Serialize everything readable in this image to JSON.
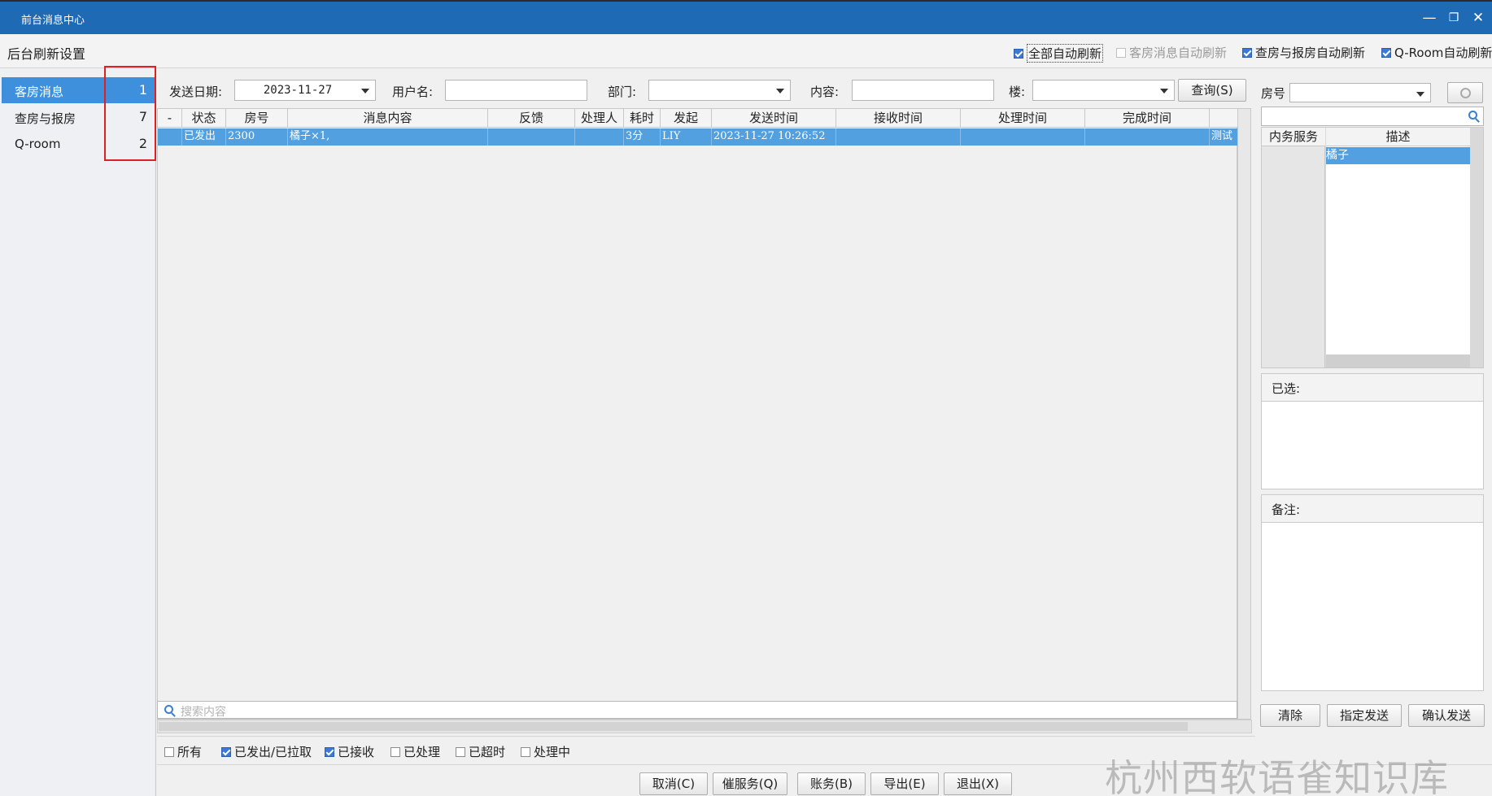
{
  "window": {
    "title": "前台消息中心",
    "minimize": "—",
    "restore": "❐",
    "close": "✕"
  },
  "settings": {
    "label": "后台刷新设置",
    "options": [
      {
        "label": "全部自动刷新",
        "checked": true
      },
      {
        "label": "客房消息自动刷新",
        "checked": false
      },
      {
        "label": "查房与报房自动刷新",
        "checked": true
      },
      {
        "label": "Q-Room自动刷新",
        "checked": true
      }
    ]
  },
  "sidebar": {
    "items": [
      {
        "label": "客房消息",
        "count": "1"
      },
      {
        "label": "查房与报房",
        "count": "7"
      },
      {
        "label": "Q-room",
        "count": "2"
      }
    ]
  },
  "filters": {
    "date_label": "发送日期:",
    "date_value": "2023-11-27",
    "user_label": "用户名:",
    "user_value": "",
    "dept_label": "部门:",
    "dept_value": "",
    "content_label": "内容:",
    "content_value": "",
    "building_label": "楼:",
    "building_value": "",
    "query_button": "查询(S)"
  },
  "table": {
    "columns": [
      "-",
      "状态",
      "房号",
      "消息内容",
      "反馈",
      "处理人",
      "耗时",
      "发起",
      "发送时间",
      "接收时间",
      "处理时间",
      "完成时间"
    ],
    "rows": [
      {
        "dash": "",
        "status": "已发出",
        "room": "2300",
        "content": "橘子×1,",
        "feedback": "",
        "handler": "",
        "duration": "3分",
        "initiator": "LIY",
        "send_time": "2023-11-27 10:26:52",
        "receive_time": "",
        "process_time": "",
        "finish_time": "",
        "extra": "测试"
      }
    ],
    "search_placeholder": "搜索内容"
  },
  "status_filters": [
    {
      "label": "所有",
      "checked": false
    },
    {
      "label": "已发出/已拉取",
      "checked": true
    },
    {
      "label": "已接收",
      "checked": true
    },
    {
      "label": "已处理",
      "checked": false
    },
    {
      "label": "已超时",
      "checked": false
    },
    {
      "label": "处理中",
      "checked": false
    }
  ],
  "right_panel": {
    "room_label": "房号",
    "room_value": "",
    "service_col": "内务服务",
    "desc_col": "描述",
    "items": [
      "橘子"
    ],
    "selected_title": "已选:",
    "remark_title": "备注:",
    "clear_button": "清除",
    "assign_button": "指定发送",
    "confirm_button": "确认发送"
  },
  "bottom_buttons": [
    "取消(C)",
    "催服务(Q)",
    "账务(B)",
    "导出(E)",
    "退出(X)"
  ],
  "watermark": "杭州西软语雀知识库",
  "colors": {
    "titlebar": "#1f6ab4",
    "selection": "#53a0e0",
    "sidebar_active": "#3f90dc",
    "highlight_box": "#e02020"
  }
}
